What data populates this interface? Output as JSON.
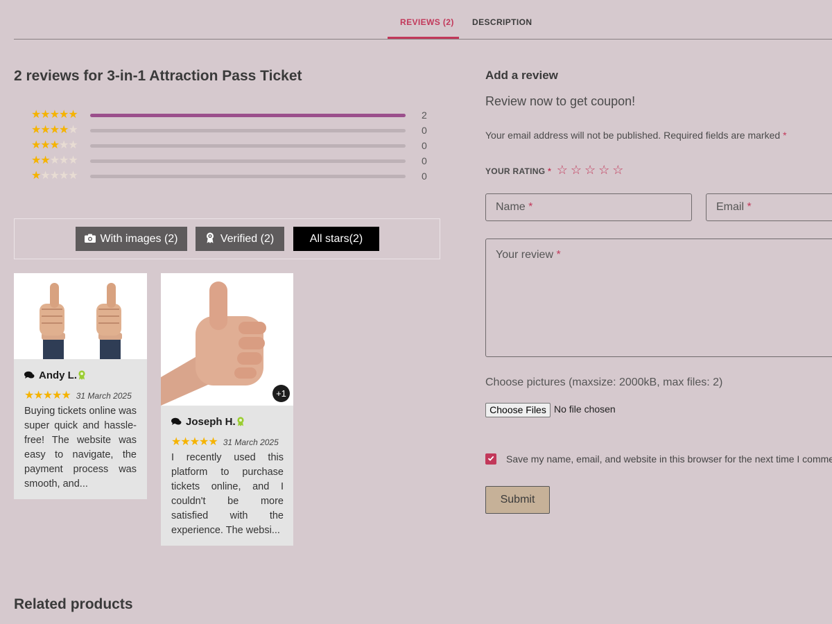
{
  "tabs": [
    {
      "label": "REVIEWS (2)",
      "active": true
    },
    {
      "label": "DESCRIPTION",
      "active": false
    }
  ],
  "reviews_title": "2 reviews for 3-in-1 Attraction Pass Ticket",
  "rating_breakdown": [
    {
      "stars": 5,
      "count": "2",
      "fraction": 1.0
    },
    {
      "stars": 4,
      "count": "0",
      "fraction": 0
    },
    {
      "stars": 3,
      "count": "0",
      "fraction": 0
    },
    {
      "stars": 2,
      "count": "0",
      "fraction": 0
    },
    {
      "stars": 1,
      "count": "0",
      "fraction": 0
    }
  ],
  "filters": {
    "with_images": "With images (2)",
    "verified": "Verified (2)",
    "all_stars": "All stars(2)"
  },
  "reviews": [
    {
      "name": "Andy L.",
      "rating": 5,
      "date": "31 March 2025",
      "text": "Buying tickets online was super quick and hassle-free! The website was easy to navigate, the payment process was smooth, and...",
      "image": "two-thumbs-up-photo",
      "extra_images": ""
    },
    {
      "name": "Joseph H.",
      "rating": 5,
      "date": "31 March 2025",
      "text": "I recently used this platform to purchase tickets online, and I couldn't be more satisfied with the experience. The websi...",
      "image": "thumb-up-photo",
      "extra_images": "+1"
    }
  ],
  "form": {
    "title": "Add a review",
    "coupon": "Review now to get coupon!",
    "note": "Your email address will not be published. Required fields are marked",
    "required_mark": "*",
    "your_rating": "YOUR RATING",
    "rating_star": "☆",
    "name_placeholder": "Name",
    "email_placeholder": "Email",
    "review_placeholder": "Your review",
    "choose_pictures": "Choose pictures (maxsize: 2000kB, max files: 2)",
    "file_button": "Choose Files",
    "no_file": "No file chosen",
    "save_text": "Save my name, email, and website in this browser for the next time I comment.",
    "save_checked": true,
    "submit": "Submit"
  },
  "related_title": "Related products",
  "colors": {
    "background": "#d6c9ce",
    "accent": "#c2385a",
    "bar_fill": "#9b4f8c",
    "star": "#f5b300",
    "submit_bg": "#c6b198"
  },
  "icons": {
    "camera": "camera-icon",
    "badge": "award-icon",
    "comments": "comments-icon",
    "verified": "verified-badge-icon",
    "check": "check-icon"
  }
}
